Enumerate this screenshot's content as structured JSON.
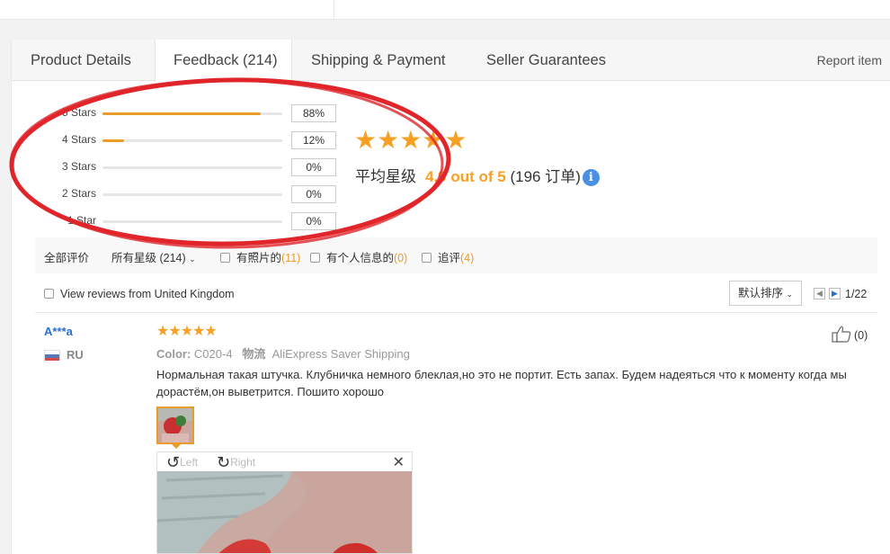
{
  "tabs": [
    {
      "label": "Product Details"
    },
    {
      "label": "Feedback (214)"
    },
    {
      "label": "Shipping & Payment"
    },
    {
      "label": "Seller Guarantees"
    }
  ],
  "report_label": "Report item",
  "distribution": [
    {
      "label": "5 Stars",
      "pct": "88%",
      "fraction": 0.88
    },
    {
      "label": "4 Stars",
      "pct": "12%",
      "fraction": 0.12
    },
    {
      "label": "3 Stars",
      "pct": "0%",
      "fraction": 0
    },
    {
      "label": "2 Stars",
      "pct": "0%",
      "fraction": 0
    },
    {
      "label": "1 Star",
      "pct": "0%",
      "fraction": 0
    }
  ],
  "summary": {
    "stars": "★★★★★",
    "avg_label": "平均星级",
    "avg_value": "4.9 out of 5",
    "orders": "(196 订单)",
    "info_glyph": "i"
  },
  "filters": {
    "all": "全部评价",
    "all_stars": "所有星级 (214)",
    "with_photos": "有照片的",
    "with_photos_count": "(11)",
    "personal_info": "有个人信息的",
    "personal_info_count": "(0)",
    "followup": "追评",
    "followup_count": "(4)"
  },
  "uk_label": "View reviews from United Kingdom",
  "sort_label": "默认排序",
  "pager": {
    "prev": "◀",
    "next": "▶",
    "text": "1/22"
  },
  "review": {
    "user": "A***a",
    "country": "RU",
    "stars": "★★★★★",
    "color_label": "Color:",
    "color_value": "C020-4",
    "logistics_label": "物流",
    "logistics_value": "AliExpress Saver Shipping",
    "text": "Нормальная такая штучка. Клубничка немного блеклая,но это не портит. Есть запах. Будем надеяться что к моменту когда мы дорастём,он выветрится. Пошито хорошо",
    "likes": "(0)"
  },
  "viewer": {
    "left_label": "Left",
    "right_label": "Right",
    "rotate_left_glyph": "↺",
    "rotate_right_glyph": "↻",
    "close_glyph": "✕"
  },
  "colors": {
    "accent_orange": "#e99c2a",
    "star_orange": "#f7a023",
    "link_blue": "#2a6fcf",
    "annotation_red": "#e0262b"
  }
}
